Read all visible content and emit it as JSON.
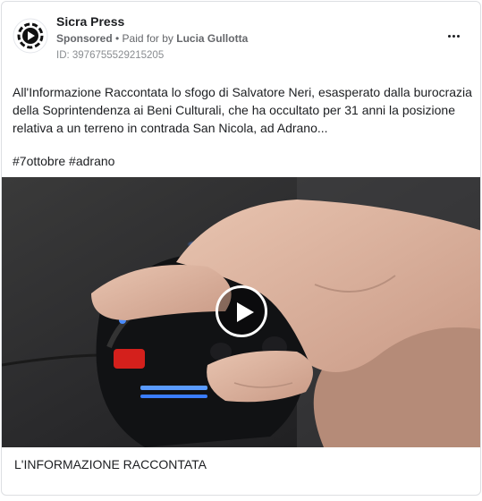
{
  "post": {
    "page_name": "Sicra Press",
    "sponsored_label": "Sponsored",
    "paid_for_prefix": " • Paid for by ",
    "payer": "Lucia Gullotta",
    "ad_id": "ID: 3976755529215205",
    "body": "All'Informazione Raccontata lo sfogo di Salvatore Neri, esasperato dalla burocrazia della Soprintendenza ai Beni Culturali, che ha occultato per 31 anni la posizione relativa a un terreno in contrada San Nicola, ad Adrano...",
    "hashtags": "#7ottobre #adrano",
    "media_caption": "L'INFORMAZIONE RACCONTATA"
  },
  "icons": {
    "avatar": "sicra-press-logo-icon",
    "more": "more-options-icon",
    "play": "play-icon"
  },
  "colors": {
    "text": "#1c1e21",
    "secondary_text": "#65676b",
    "border": "#dddfe2",
    "mouse_led": "#3a7dff",
    "mouse_button": "#e02020"
  }
}
